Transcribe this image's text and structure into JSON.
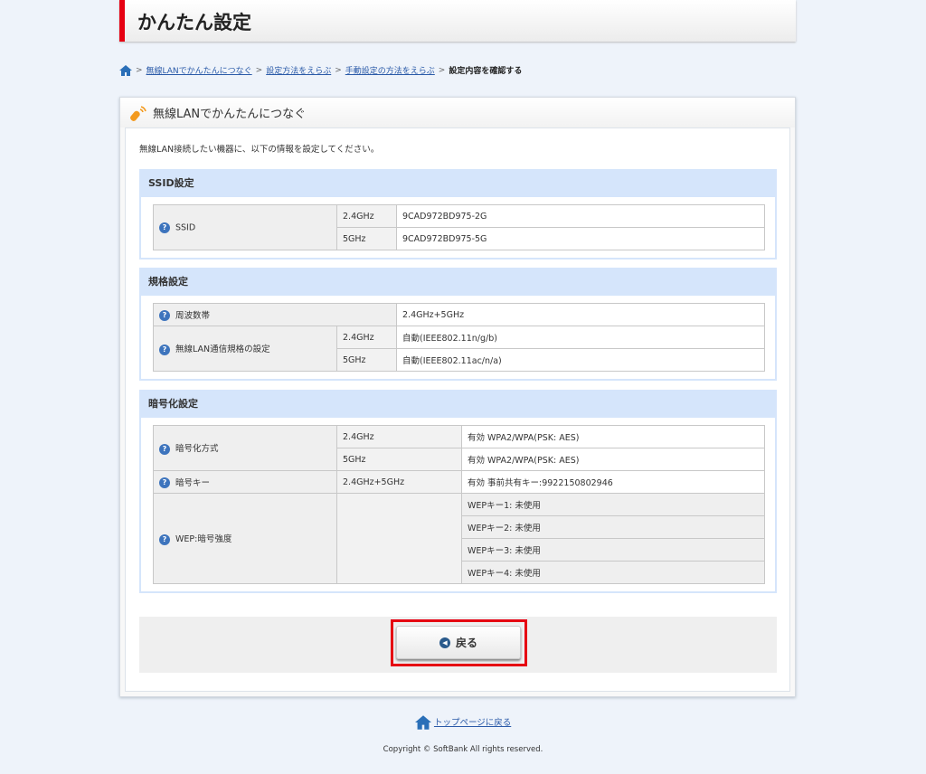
{
  "header": {
    "title": "かんたん設定"
  },
  "breadcrumb": {
    "items": [
      "無線LANでかんたんにつなぐ",
      "設定方法をえらぶ",
      "手動設定の方法をえらぶ"
    ],
    "current": "設定内容を確認する"
  },
  "panel": {
    "title": "無線LANでかんたんにつなぐ",
    "intro": "無線LAN接続したい機器に、以下の情報を設定してください。"
  },
  "ssid": {
    "heading": "SSID設定",
    "label": "SSID",
    "rows": [
      {
        "band": "2.4GHz",
        "value": "9CAD972BD975-2G"
      },
      {
        "band": "5GHz",
        "value": "9CAD972BD975-5G"
      }
    ]
  },
  "spec": {
    "heading": "規格設定",
    "freq_label": "周波数帯",
    "freq_value": "2.4GHz+5GHz",
    "std_label": "無線LAN通信規格の設定",
    "rows": [
      {
        "band": "2.4GHz",
        "value": "自動(IEEE802.11n/g/b)"
      },
      {
        "band": "5GHz",
        "value": "自動(IEEE802.11ac/n/a)"
      }
    ]
  },
  "enc": {
    "heading": "暗号化設定",
    "method_label": "暗号化方式",
    "rows": [
      {
        "band": "2.4GHz",
        "value": "有効 WPA2/WPA(PSK: AES)"
      },
      {
        "band": "5GHz",
        "value": "有効 WPA2/WPA(PSK: AES)"
      }
    ],
    "key_label": "暗号キー",
    "key_band": "2.4GHz+5GHz",
    "key_value": "有効 事前共有キー:9922150802946",
    "wep_label": "WEP:暗号強度",
    "wep": [
      "WEPキー1: 未使用",
      "WEPキー2: 未使用",
      "WEPキー3: 未使用",
      "WEPキー4: 未使用"
    ]
  },
  "back_button": "戻る",
  "footer": {
    "top_link": "トップページに戻る",
    "copyright": "Copyright © SoftBank All rights reserved."
  }
}
